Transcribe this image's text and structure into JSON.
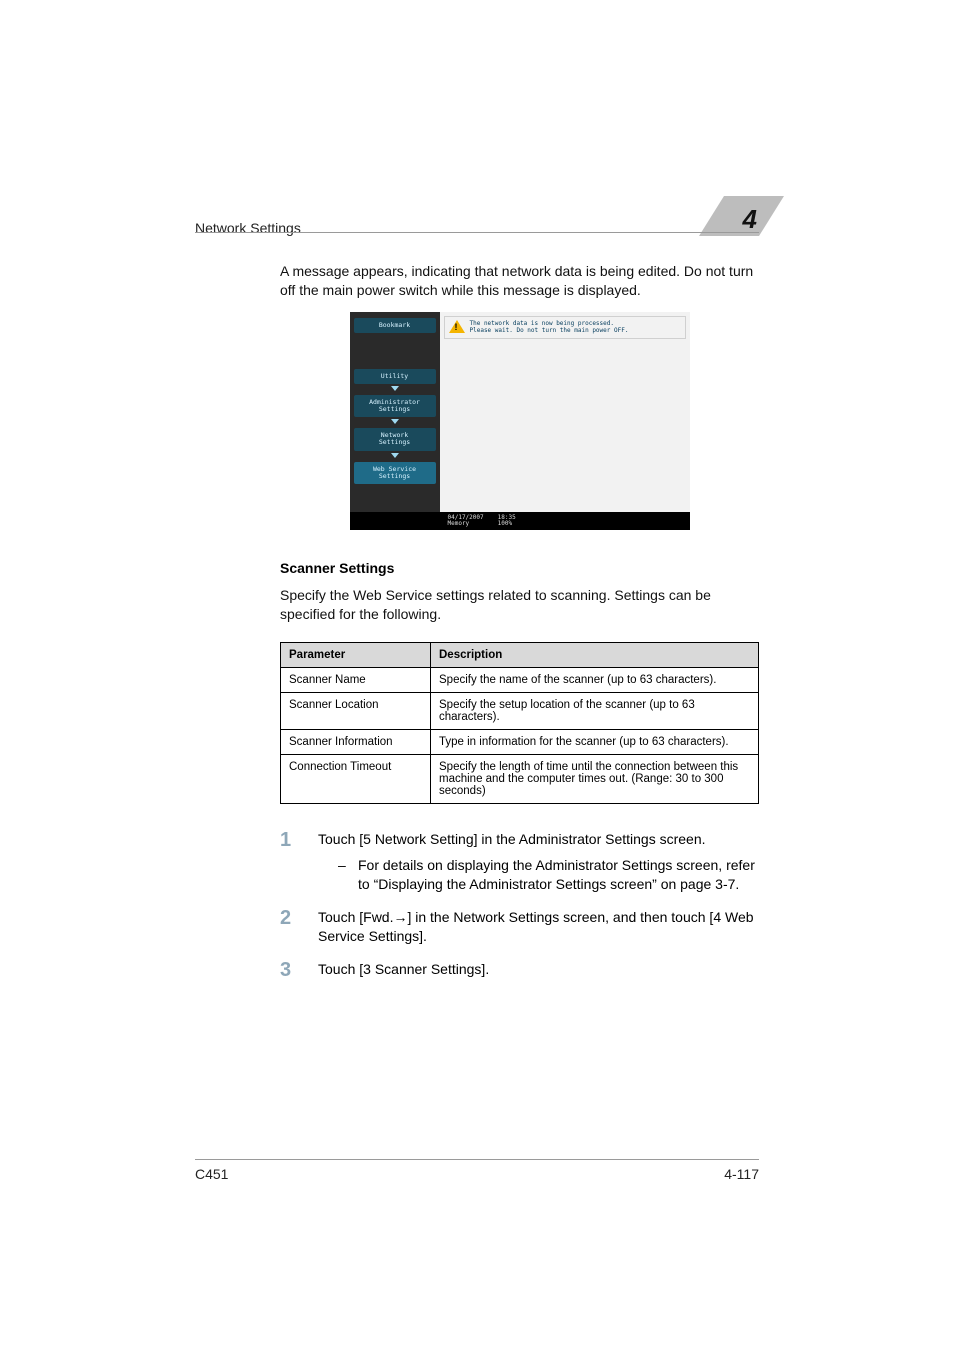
{
  "header": {
    "running_title": "Network Settings",
    "chapter_number": "4"
  },
  "intro_paragraph": "A message appears, indicating that network data is being edited. Do not turn off the main power switch while this message is displayed.",
  "device_screenshot": {
    "sidebar": {
      "bookmark": "Bookmark",
      "items": [
        "Utility",
        "Administrator\nSettings",
        "Network\nSettings",
        "Web Service\nSettings"
      ]
    },
    "alert": {
      "line1": "The network data is now being processed.",
      "line2": "Please wait. Do not turn the main power OFF."
    },
    "status": {
      "date": "04/17/2007",
      "time": "18:35",
      "memory_label": "Memory",
      "memory_value": "100%"
    }
  },
  "section_title": "Scanner Settings",
  "section_intro": "Specify the Web Service settings related to scanning. Settings can be specified for the following.",
  "table": {
    "head": {
      "c1": "Parameter",
      "c2": "Description"
    },
    "rows": [
      {
        "c1": "Scanner Name",
        "c2": "Specify the name of the scanner (up to 63 characters)."
      },
      {
        "c1": "Scanner Location",
        "c2": "Specify the setup location of the scanner (up to 63 characters)."
      },
      {
        "c1": "Scanner Information",
        "c2": "Type in information for the scanner (up to 63 characters)."
      },
      {
        "c1": "Connection Timeout",
        "c2": "Specify the length of time until the connection between this machine and the computer times out. (Range: 30 to 300 seconds)"
      }
    ]
  },
  "steps": [
    {
      "n": "1",
      "text": "Touch [5 Network Setting] in the Administrator Settings screen.",
      "sub": "For details on displaying the Administrator Settings screen, refer to “Displaying the Administrator Settings screen” on page 3-7."
    },
    {
      "n": "2",
      "text": "Touch [Fwd.→] in the Network Settings screen, and then touch [4 Web Service Settings]."
    },
    {
      "n": "3",
      "text": "Touch [3 Scanner Settings]."
    }
  ],
  "footer": {
    "left": "C451",
    "right": "4-117"
  }
}
